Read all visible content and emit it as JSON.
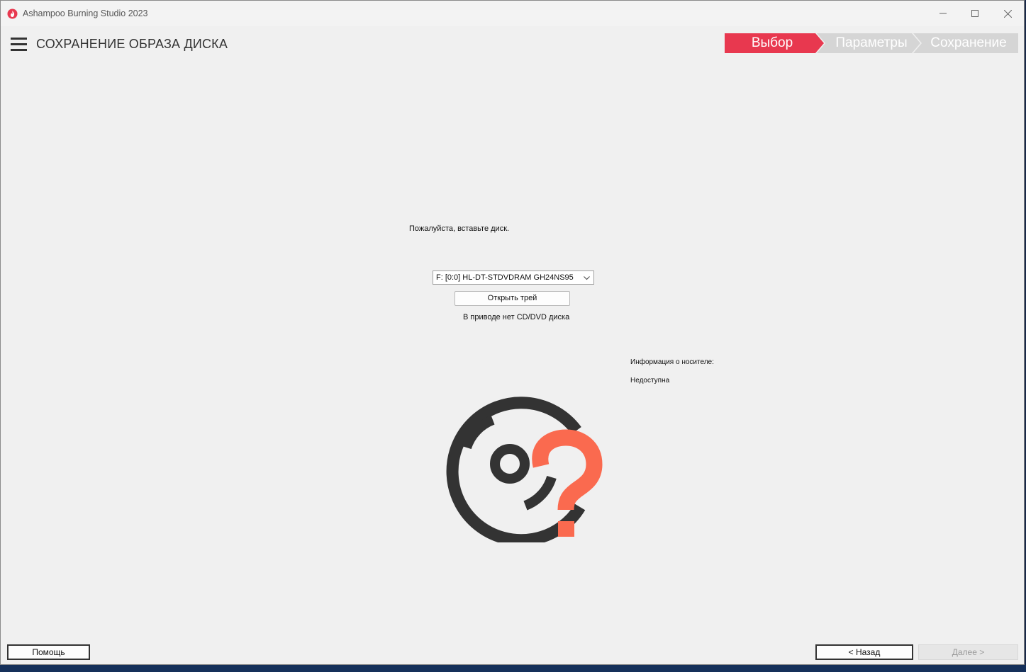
{
  "window": {
    "title": "Ashampoo Burning Studio 2023"
  },
  "header": {
    "page_title": "СОХРАНЕНИЕ ОБРАЗА ДИСКА",
    "steps": [
      {
        "label": "Выбор",
        "active": true
      },
      {
        "label": "Параметры",
        "active": false
      },
      {
        "label": "Сохранение",
        "active": false
      }
    ]
  },
  "main": {
    "prompt": "Пожалуйста, вставьте диск.",
    "drive_select_value": "F: [0:0] HL-DT-STDVDRAM GH24NS95",
    "open_tray_label": "Открыть трей",
    "no_disc_text": "В приводе нет CD/DVD диска",
    "media_info_label": "Информация о носителе:",
    "media_info_value": "Недоступна"
  },
  "footer": {
    "help_label": "Помощь",
    "back_label": "< Назад",
    "next_label": "Далее >"
  },
  "colors": {
    "accent": "#e8384f",
    "step_inactive": "#d5d5d5",
    "question_mark": "#fa6a4f",
    "disc": "#333333"
  },
  "icons": {
    "app": "ashampoo-flame-icon",
    "menu": "hamburger-icon",
    "disc": "disc-question-icon"
  }
}
